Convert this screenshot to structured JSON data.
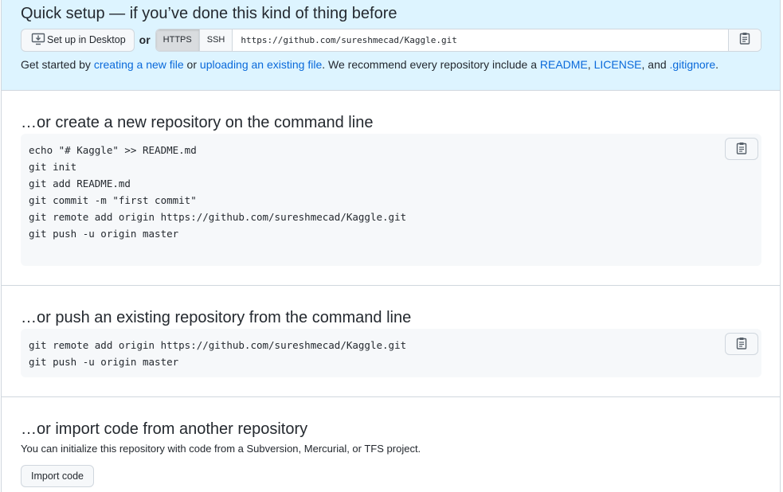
{
  "quick_setup": {
    "title": "Quick setup — if you’ve done this kind of thing before",
    "desktop_button": "Set up in Desktop",
    "or_label": "or",
    "protocols": [
      "HTTPS",
      "SSH"
    ],
    "selected_protocol": "HTTPS",
    "clone_url": "https://github.com/sureshmecad/Kaggle.git",
    "get_started": {
      "prefix": "Get started by ",
      "link_new_file": "creating a new file",
      "or": " or ",
      "link_upload": "uploading an existing file",
      "middle": ". We recommend every repository include a ",
      "link_readme": "README",
      "comma1": ", ",
      "link_license": "LICENSE",
      "and": ", and ",
      "link_gitignore": ".gitignore",
      "suffix": "."
    }
  },
  "new_repo": {
    "title": "…or create a new repository on the command line",
    "lines": [
      "echo \"# Kaggle\" >> README.md",
      "git init",
      "git add README.md",
      "git commit -m \"first commit\"",
      "git remote add origin https://github.com/sureshmecad/Kaggle.git",
      "git push -u origin master"
    ]
  },
  "push_existing": {
    "title": "…or push an existing repository from the command line",
    "lines": [
      "git remote add origin https://github.com/sureshmecad/Kaggle.git",
      "git push -u origin master"
    ]
  },
  "import": {
    "title": "…or import code from another repository",
    "description": "You can initialize this repository with code from a Subversion, Mercurial, or TFS project.",
    "button": "Import code"
  },
  "icons": {
    "desktop": "desktop-download-icon",
    "copy": "clipboard-icon"
  },
  "colors": {
    "quick_setup_bg": "#ddf4ff",
    "link": "#0969da",
    "code_bg": "#f6f8fa",
    "border": "#d0d7de"
  }
}
